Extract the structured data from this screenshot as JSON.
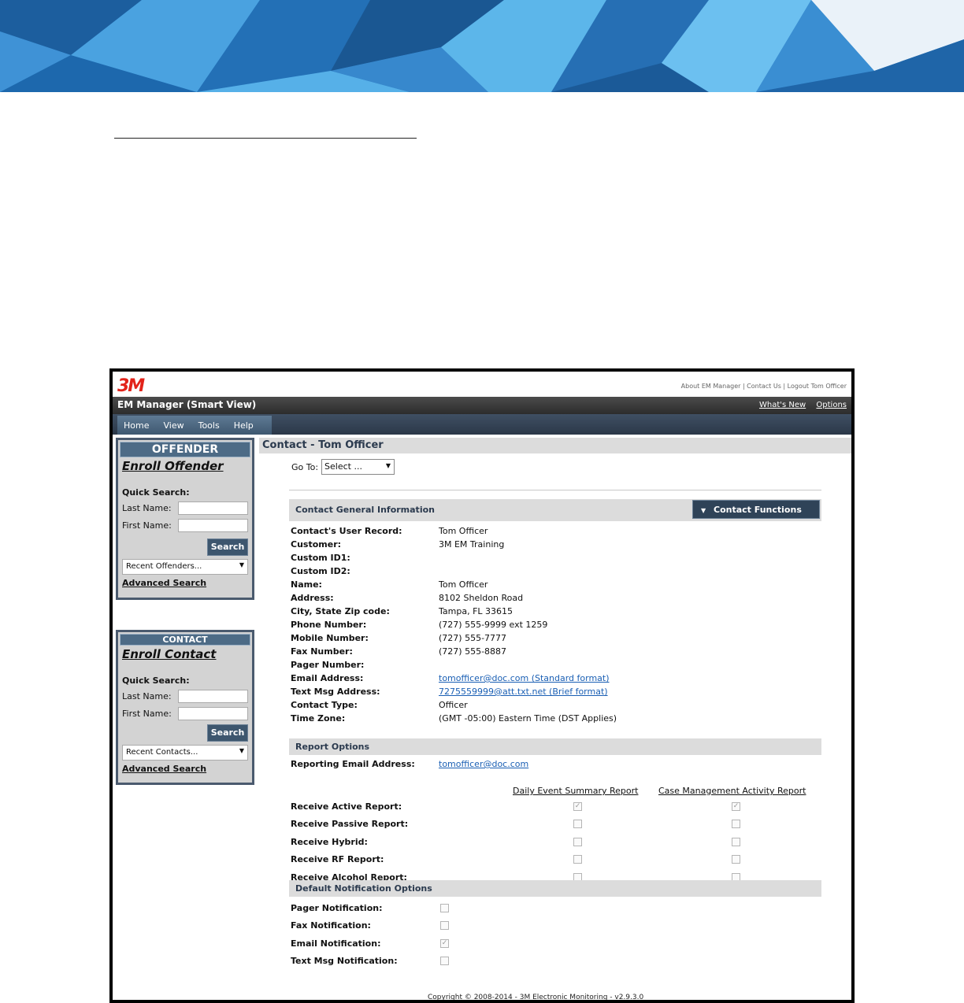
{
  "app": {
    "logo": "3M",
    "top_links": "About EM Manager | Contact Us | Logout Tom Officer",
    "title": "EM Manager (Smart View)",
    "whats_new": "What's New",
    "options": "Options",
    "menu": [
      "Home",
      "View",
      "Tools",
      "Help"
    ]
  },
  "offender_box": {
    "header": "OFFENDER",
    "enroll": "Enroll Offender",
    "quick_search": "Quick Search:",
    "last_name": "Last Name:",
    "first_name": "First Name:",
    "search": "Search",
    "recent": "Recent Offenders...",
    "advanced": "Advanced Search"
  },
  "contact_box": {
    "header": "CONTACT",
    "enroll": "Enroll Contact",
    "quick_search": "Quick Search:",
    "last_name": "Last Name:",
    "first_name": "First Name:",
    "search": "Search",
    "recent": "Recent Contacts...",
    "advanced": "Advanced Search"
  },
  "page": {
    "title": "Contact - Tom Officer",
    "goto_label": "Go To:",
    "goto_value": "Select ..."
  },
  "general": {
    "header": "Contact General Information",
    "functions_button": "Contact Functions",
    "fields": [
      {
        "k": "Contact's User Record:",
        "v": "Tom Officer"
      },
      {
        "k": "Customer:",
        "v": "3M EM Training"
      },
      {
        "k": "Custom ID1:",
        "v": ""
      },
      {
        "k": "Custom ID2:",
        "v": ""
      },
      {
        "k": "Name:",
        "v": "Tom Officer"
      },
      {
        "k": "Address:",
        "v": "8102 Sheldon Road"
      },
      {
        "k": "City, State Zip code:",
        "v": "Tampa, FL 33615"
      },
      {
        "k": "Phone Number:",
        "v": "(727) 555-9999 ext 1259"
      },
      {
        "k": "Mobile Number:",
        "v": "(727) 555-7777"
      },
      {
        "k": "Fax Number:",
        "v": "(727) 555-8887"
      },
      {
        "k": "Pager Number:",
        "v": ""
      },
      {
        "k": "Email Address:",
        "v": "tomofficer@doc.com (Standard format)"
      },
      {
        "k": "Text Msg Address:",
        "v": "7275559999@att.txt.net (Brief format)"
      },
      {
        "k": "Contact Type:",
        "v": "Officer"
      },
      {
        "k": "Time Zone:",
        "v": "(GMT -05:00) Eastern Time (DST Applies)"
      }
    ]
  },
  "report": {
    "header": "Report Options",
    "email_label": "Reporting Email Address:",
    "email_value": "tomofficer@doc.com",
    "col1": "Daily Event Summary Report",
    "col2": "Case Management Activity Report",
    "rows": [
      {
        "label": "Receive Active Report:",
        "c1": true,
        "c2": true
      },
      {
        "label": "Receive Passive Report:",
        "c1": false,
        "c2": false
      },
      {
        "label": "Receive Hybrid:",
        "c1": false,
        "c2": false
      },
      {
        "label": "Receive RF Report:",
        "c1": false,
        "c2": false
      },
      {
        "label": "Receive Alcohol Report:",
        "c1": false,
        "c2": false
      }
    ]
  },
  "notify": {
    "header": "Default Notification Options",
    "rows": [
      {
        "label": "Pager Notification:",
        "checked": false
      },
      {
        "label": "Fax Notification:",
        "checked": false
      },
      {
        "label": "Email Notification:",
        "checked": true
      },
      {
        "label": "Text Msg Notification:",
        "checked": false
      }
    ]
  },
  "footer": {
    "copyright": "Copyright © 2008-2014 - 3M Electronic Monitoring - v2.9.3.0"
  }
}
